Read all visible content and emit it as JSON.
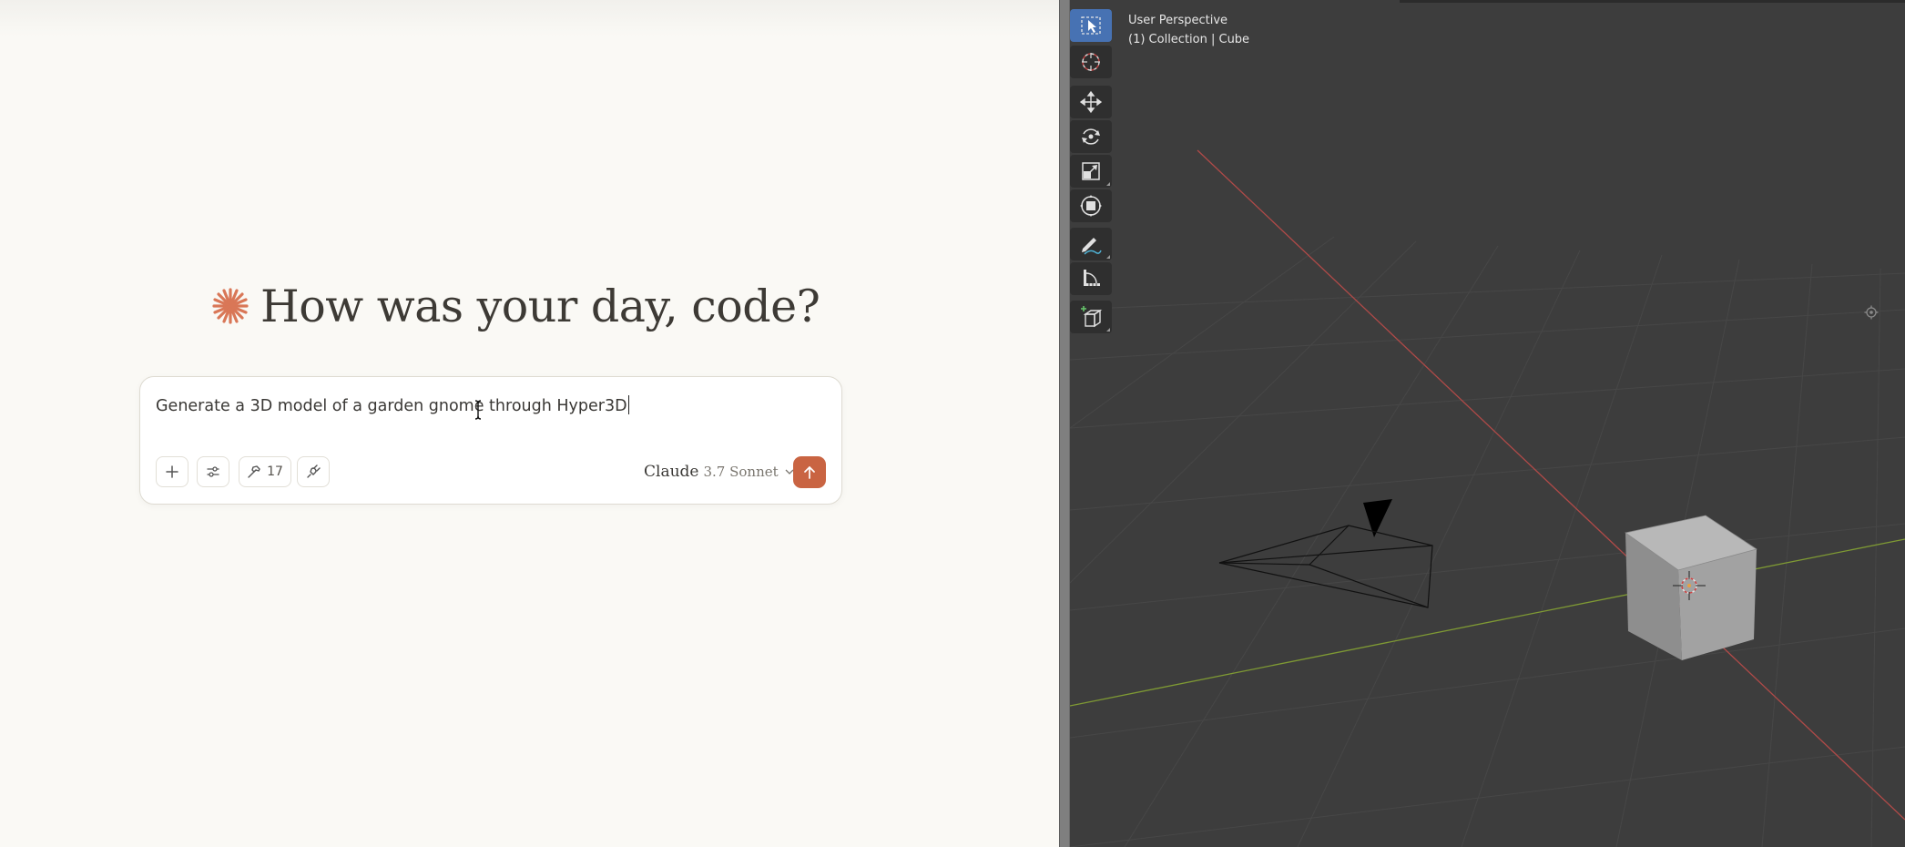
{
  "claude": {
    "greeting": "How was your day, code?",
    "prompt_text": "Generate a 3D model of a garden gnome through Hyper3D",
    "tools_count": "17",
    "model_name": "Claude",
    "model_version": "3.7 Sonnet",
    "accent_color": "#c96442",
    "icons": [
      "spark-icon",
      "plus-icon",
      "sliders-icon",
      "hammer-icon",
      "plug-icon",
      "chevron-down-icon",
      "arrow-up-icon"
    ]
  },
  "blender": {
    "view_name": "User Perspective",
    "collection_label": "(1) Collection | Cube",
    "toolbar_tools": [
      "Select Box",
      "Cursor",
      "Move",
      "Rotate",
      "Scale",
      "Transform",
      "Annotate",
      "Measure",
      "Add Cube"
    ],
    "colors": {
      "background": "#3d3d3d",
      "x_axis": "#c0514f",
      "y_axis": "#8aa33a",
      "active_tool": "#4772b3"
    }
  }
}
